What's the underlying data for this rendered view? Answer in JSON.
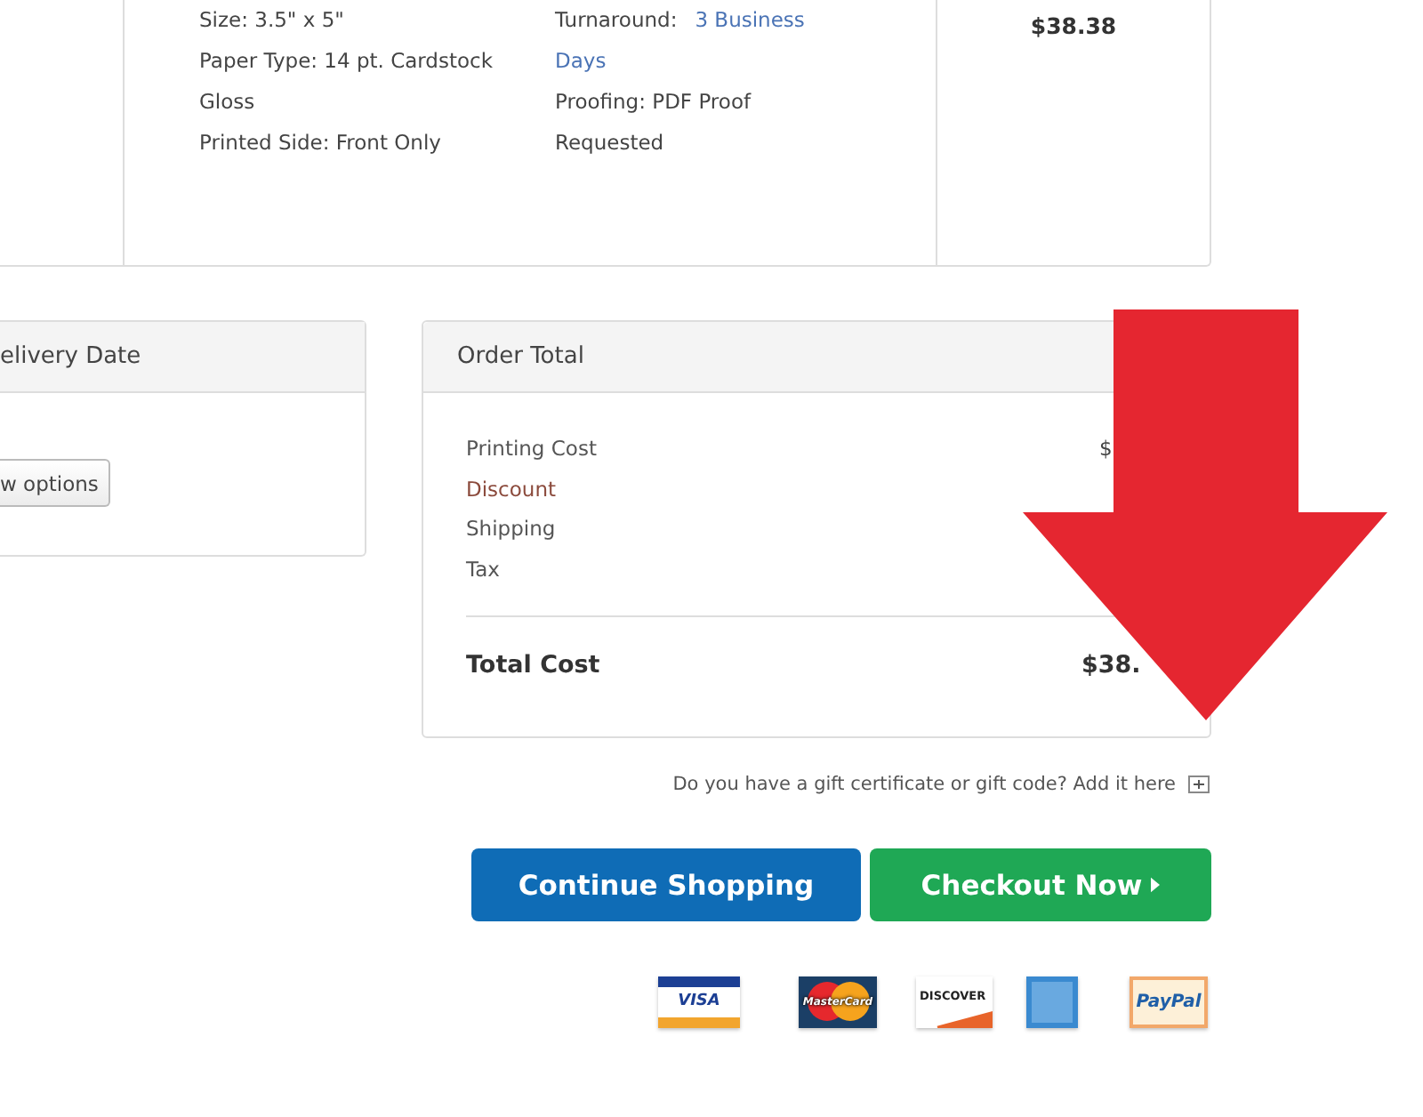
{
  "item": {
    "specs": [
      "Size: 3.5\" x 5\"",
      "Paper Type: 14 pt. Cardstock",
      "Gloss",
      "Printed Side: Front Only"
    ],
    "turnaround": {
      "label": "Turnaround:",
      "value": "3 Business Days"
    },
    "proofing": "Proofing: PDF Proof Requested",
    "price": "$38.38"
  },
  "delivery": {
    "title": "elivery Date",
    "button": "w options"
  },
  "order_total": {
    "title": "Order Total",
    "rows": [
      {
        "label": "Printing Cost",
        "value": "$",
        "kind": "cost"
      },
      {
        "label": "Discount",
        "kind": "discount"
      },
      {
        "label": "Shipping",
        "kind": "cost"
      },
      {
        "label": "Tax",
        "kind": "cost"
      }
    ],
    "total": {
      "label": "Total Cost",
      "value": "$38."
    }
  },
  "gift_prompt": "Do you have a gift certificate or gift code? Add it here",
  "buttons": [
    {
      "label": "Continue Shopping",
      "kind": "secondary"
    },
    {
      "label": "Checkout Now",
      "kind": "primary"
    }
  ],
  "payment_methods": [
    {
      "kind": "visa",
      "label": "VISA"
    },
    {
      "kind": "mastercard",
      "label": "MasterCard"
    },
    {
      "kind": "discover",
      "label": "DISCOVER"
    },
    {
      "kind": "amex"
    },
    {
      "kind": "paypal",
      "label": "PayPal"
    }
  ]
}
